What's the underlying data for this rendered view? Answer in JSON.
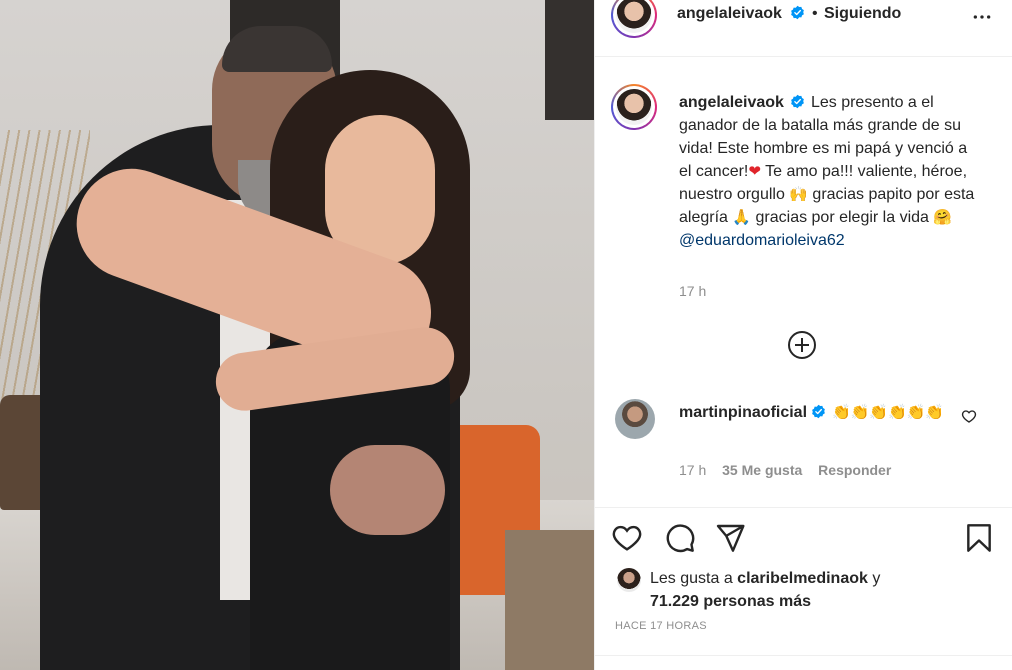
{
  "post": {
    "username": "angelaleivaok",
    "header_dot": "•",
    "follow_status": "Siguiendo",
    "more_icon": "more-options-icon"
  },
  "caption": {
    "username": "angelaleivaok",
    "line1": "Les presento a el ganador de la batalla más grande de su vida! Este hombre es mi papá y venció a el cancer!",
    "heart": "❤",
    "line2": " Te amo pa!!! valiente, héroe, nuestro orgullo ",
    "emoji_raised_hands": "🙌",
    "line3": " gracias papito por esta alegría ",
    "emoji_pray": "🙏",
    "line4": " gracias por elegir la vida ",
    "emoji_hug": "🤗",
    "mention": "@eduardomarioleiva62",
    "time": "17 h"
  },
  "comment": {
    "username": "martinpinaoficial",
    "text": "👏👏👏👏👏👏",
    "time": "17 h",
    "likes": "35 Me gusta",
    "reply": "Responder"
  },
  "likes": {
    "prefix": "Les gusta a ",
    "user": "claribelmedinaok",
    "conj": " y",
    "count": "71.229 personas más"
  },
  "timestamp": "HACE 17 HORAS",
  "colors": {
    "accent": "#0095f6",
    "heart": "#e0242b",
    "muted": "#8e8e8e",
    "mention": "#00376b"
  }
}
